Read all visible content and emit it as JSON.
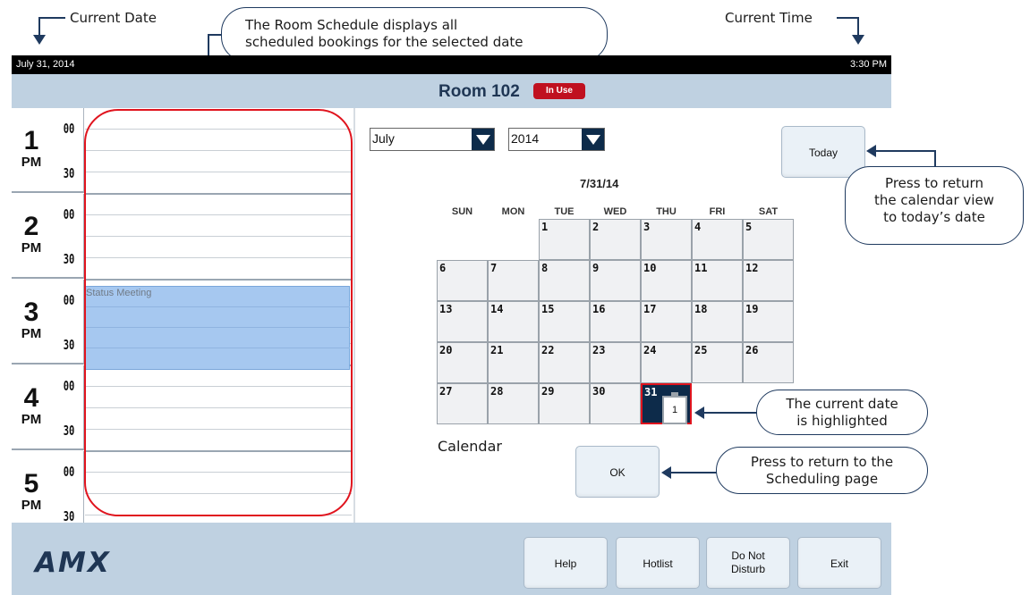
{
  "annotations": {
    "current_date": "Current Date",
    "current_time": "Current Time",
    "schedule_l1": "The Room Schedule displays all",
    "schedule_l2": "scheduled bookings for the selected date",
    "today_l1": "Press to return",
    "today_l2": "the calendar view",
    "today_l3": "to today’s date",
    "highlight_l1": "The current date",
    "highlight_l2": "is highlighted",
    "ok_l1": "Press to return to the",
    "ok_l2": "Scheduling page",
    "calendar_caption": "Calendar"
  },
  "status_bar": {
    "date": "July 31, 2014",
    "time": "3:30 PM"
  },
  "header": {
    "room": "Room 102",
    "status": "In Use"
  },
  "schedule": {
    "hours": [
      {
        "num": "1",
        "pm": "PM",
        "m00": "00",
        "m30": "30"
      },
      {
        "num": "2",
        "pm": "PM",
        "m00": "00",
        "m30": "30"
      },
      {
        "num": "3",
        "pm": "PM",
        "m00": "00",
        "m30": "30"
      },
      {
        "num": "4",
        "pm": "PM",
        "m00": "00",
        "m30": "30"
      },
      {
        "num": "5",
        "pm": "PM",
        "m00": "00",
        "m30": "30"
      }
    ],
    "meeting": "Status Meeting"
  },
  "calendar": {
    "month": "July",
    "year": "2014",
    "today_button": "Today",
    "selected": "7/31/14",
    "days_of_week": [
      "SUN",
      "MON",
      "TUE",
      "WED",
      "THU",
      "FRI",
      "SAT"
    ],
    "dates": [
      "1",
      "2",
      "3",
      "4",
      "5",
      "6",
      "7",
      "8",
      "9",
      "10",
      "11",
      "12",
      "13",
      "14",
      "15",
      "16",
      "17",
      "18",
      "19",
      "20",
      "21",
      "22",
      "23",
      "24",
      "25",
      "26",
      "27",
      "28",
      "29",
      "30",
      "31"
    ],
    "today_icon_number": "1",
    "ok_button": "OK"
  },
  "footer": {
    "logo": "AMX",
    "buttons": [
      "Help",
      "Hotlist",
      "Do Not Disturb",
      "Exit"
    ]
  },
  "colors": {
    "accent": "#0d2b4a",
    "header_bg": "#bfd1e1",
    "in_use": "#c0101f",
    "highlight": "#e0141e",
    "meeting": "#a6c8f0"
  }
}
